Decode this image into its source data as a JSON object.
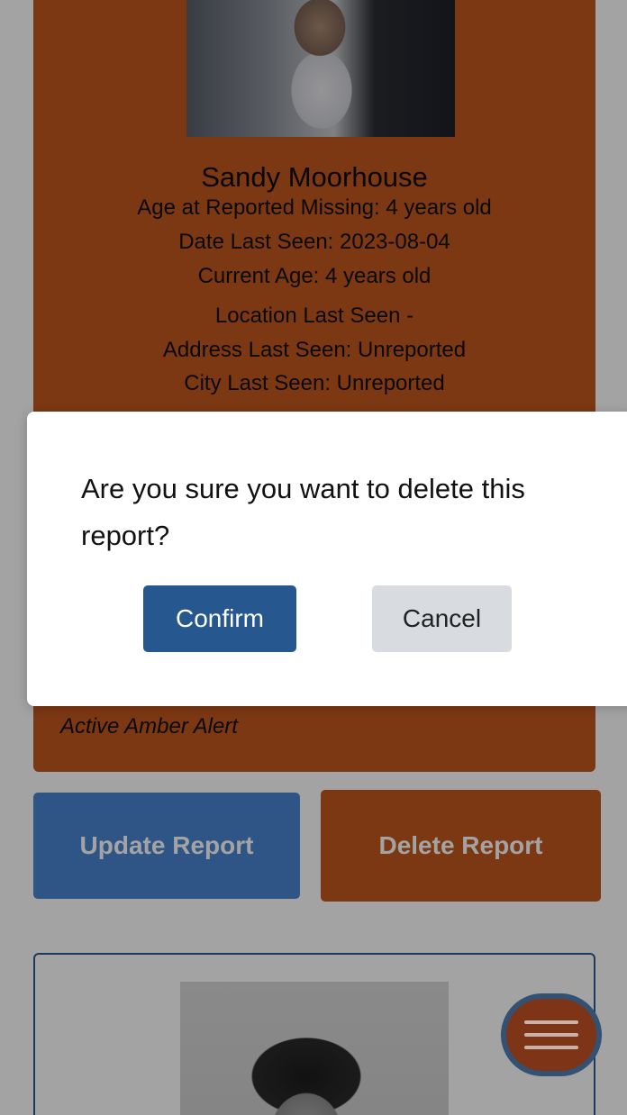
{
  "report": {
    "name": "Sandy Moorhouse",
    "age_at_missing": "Age at Reported Missing: 4 years old",
    "date_last_seen": "Date Last Seen: 2023-08-04",
    "current_age": "Current Age: 4 years old",
    "location_heading": "Location Last Seen -",
    "address_last_seen": "Address Last Seen: Unreported",
    "city_last_seen": "City Last Seen: Unreported",
    "alert_status": "Active Amber Alert"
  },
  "actions": {
    "update_label": "Update Report",
    "delete_label": "Delete Report"
  },
  "dialog": {
    "message": "Are you sure you want to delete this report?",
    "confirm_label": "Confirm",
    "cancel_label": "Cancel"
  },
  "menu": {
    "icon": "hamburger-menu-icon"
  },
  "colors": {
    "card_orange": "#c2561e",
    "update_blue": "#4a86d4",
    "confirm_blue": "#26578e",
    "cancel_gray": "#d8dbe0"
  }
}
